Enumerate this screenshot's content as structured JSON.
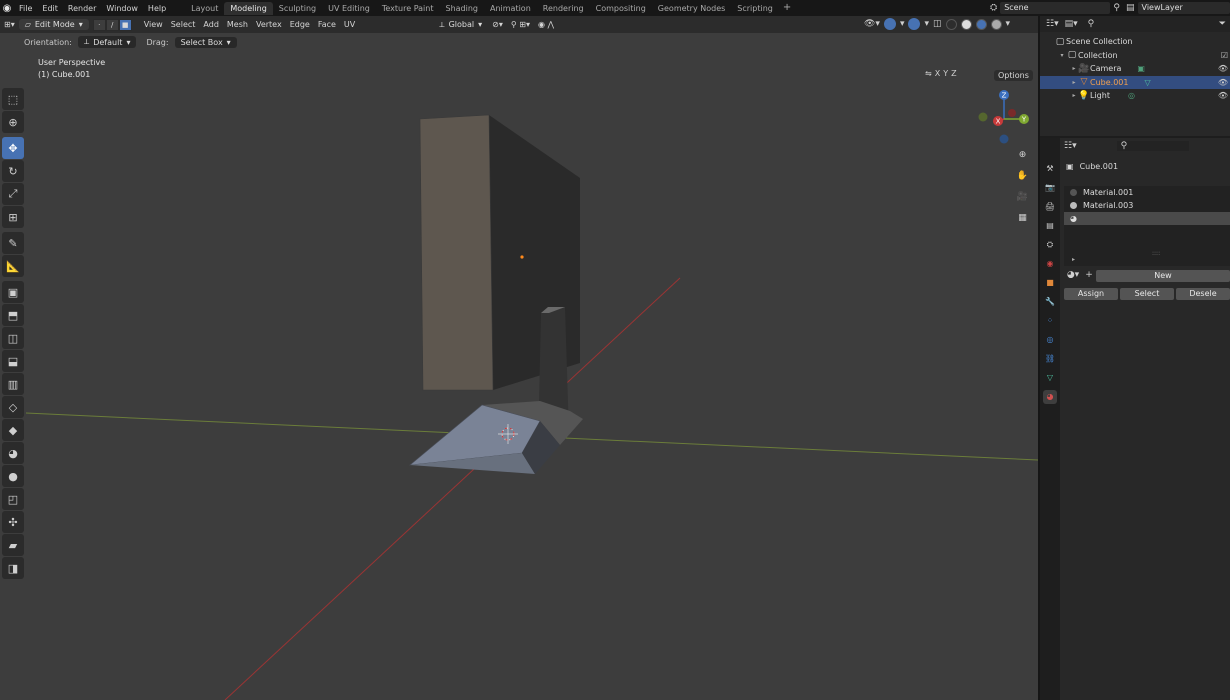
{
  "app_menu": [
    "File",
    "Edit",
    "Render",
    "Window",
    "Help"
  ],
  "workspaces": [
    {
      "label": "Layout",
      "active": false
    },
    {
      "label": "Modeling",
      "active": true
    },
    {
      "label": "Sculpting",
      "active": false
    },
    {
      "label": "UV Editing",
      "active": false
    },
    {
      "label": "Texture Paint",
      "active": false
    },
    {
      "label": "Shading",
      "active": false
    },
    {
      "label": "Animation",
      "active": false
    },
    {
      "label": "Rendering",
      "active": false
    },
    {
      "label": "Compositing",
      "active": false
    },
    {
      "label": "Geometry Nodes",
      "active": false
    },
    {
      "label": "Scripting",
      "active": false
    }
  ],
  "scene": "Scene",
  "view_layer": "ViewLayer",
  "header": {
    "mode": "Edit Mode",
    "menus": [
      "View",
      "Select",
      "Add",
      "Mesh",
      "Vertex",
      "Edge",
      "Face",
      "UV"
    ],
    "transform_orientation": "Global"
  },
  "header2": {
    "orientation_label": "Orientation:",
    "orientation_value": "Default",
    "drag_label": "Drag:",
    "drag_value": "Select Box"
  },
  "viewport": {
    "perspective": "User Perspective",
    "object": "(1) Cube.001",
    "axes": [
      "X",
      "Y",
      "Z"
    ],
    "options": "Options",
    "gizmo": {
      "x": "X",
      "y": "Y",
      "z": "Z"
    }
  },
  "outliner": {
    "root": "Scene Collection",
    "collection": "Collection",
    "items": [
      {
        "label": "Camera",
        "selected": false
      },
      {
        "label": "Cube.001",
        "selected": true
      },
      {
        "label": "Light",
        "selected": false
      }
    ]
  },
  "properties": {
    "object_name": "Cube.001",
    "materials": [
      "Material.001",
      "Material.003",
      ""
    ],
    "new_label": "New",
    "assign": "Assign",
    "select": "Select",
    "deselect": "Desele"
  }
}
